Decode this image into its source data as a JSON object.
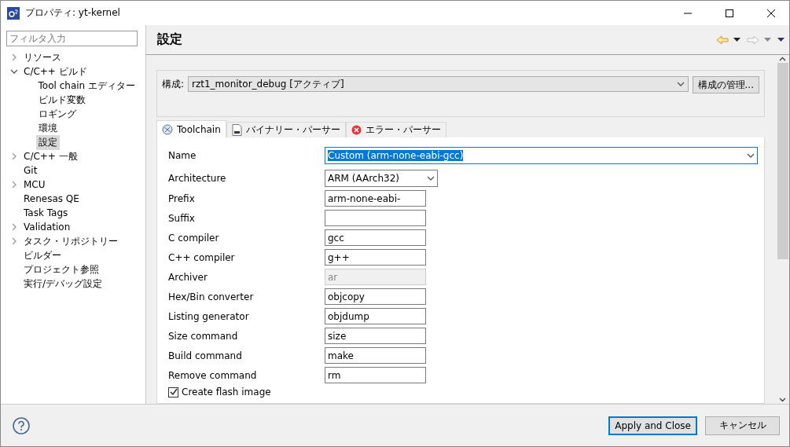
{
  "window": {
    "title": "プロパティ: yt-kernel"
  },
  "sidebar": {
    "filter": {
      "placeholder": "フィルタ入力"
    },
    "items": [
      {
        "label": "リソース",
        "expanded": false,
        "selected": false
      },
      {
        "label": "C/C++ ビルド",
        "expanded": true,
        "selected": false,
        "children": [
          {
            "label": "Tool chain エディター",
            "selected": false
          },
          {
            "label": "ビルド変数",
            "selected": false
          },
          {
            "label": "ロギング",
            "selected": false
          },
          {
            "label": "環境",
            "selected": false
          },
          {
            "label": "設定",
            "selected": true
          }
        ]
      },
      {
        "label": "C/C++ 一般",
        "expanded": false,
        "selected": false
      },
      {
        "label": "Git",
        "selected": false
      },
      {
        "label": "MCU",
        "expanded": false,
        "selected": false
      },
      {
        "label": "Renesas QE",
        "selected": false
      },
      {
        "label": "Task Tags",
        "selected": false
      },
      {
        "label": "Validation",
        "expanded": false,
        "selected": false
      },
      {
        "label": "タスク・リポジトリー",
        "expanded": false,
        "selected": false
      },
      {
        "label": "ビルダー",
        "selected": false
      },
      {
        "label": "プロジェクト参照",
        "selected": false
      },
      {
        "label": "実行/デバッグ設定",
        "selected": false
      }
    ]
  },
  "page": {
    "title": "設定",
    "configuration": {
      "label": "構成:",
      "value": "rzt1_monitor_debug  [アクティブ]",
      "button": "構成の管理..."
    },
    "tabs": [
      {
        "label": "Toolchain",
        "selected": true
      },
      {
        "label": "バイナリー・パーサー",
        "selected": false
      },
      {
        "label": "エラー・パーサー",
        "selected": false
      }
    ],
    "fields": [
      {
        "label": "Name",
        "kind": "combo",
        "value": "Custom (arm-none-eabi-gcc)",
        "wide": true,
        "highlighted": true
      },
      {
        "label": "Architecture",
        "kind": "combo",
        "value": "ARM (AArch32)",
        "wide": false,
        "highlighted": false
      },
      {
        "label": "Prefix",
        "kind": "text",
        "value": "arm-none-eabi-",
        "disabled": false
      },
      {
        "label": "Suffix",
        "kind": "text",
        "disabled": false
      },
      {
        "label": "C compiler",
        "kind": "text",
        "value": "gcc",
        "disabled": false
      },
      {
        "label": "C++ compiler",
        "kind": "text",
        "value": "g++",
        "disabled": false
      },
      {
        "label": "Archiver",
        "kind": "text",
        "value": "ar",
        "disabled": true
      },
      {
        "label": "Hex/Bin converter",
        "kind": "text",
        "value": "objcopy",
        "disabled": false
      },
      {
        "label": "Listing generator",
        "kind": "text",
        "value": "objdump",
        "disabled": false
      },
      {
        "label": "Size command",
        "kind": "text",
        "value": "size",
        "disabled": false
      },
      {
        "label": "Build command",
        "kind": "text",
        "value": "make",
        "disabled": false
      },
      {
        "label": "Remove command",
        "kind": "text",
        "value": "rm",
        "disabled": false
      },
      {
        "label": "Create flash image",
        "kind": "checkbox",
        "checked": true
      }
    ]
  },
  "buttons": [
    {
      "label": "Apply and Close",
      "default": true
    },
    {
      "label": "キャンセル",
      "default": false
    }
  ]
}
